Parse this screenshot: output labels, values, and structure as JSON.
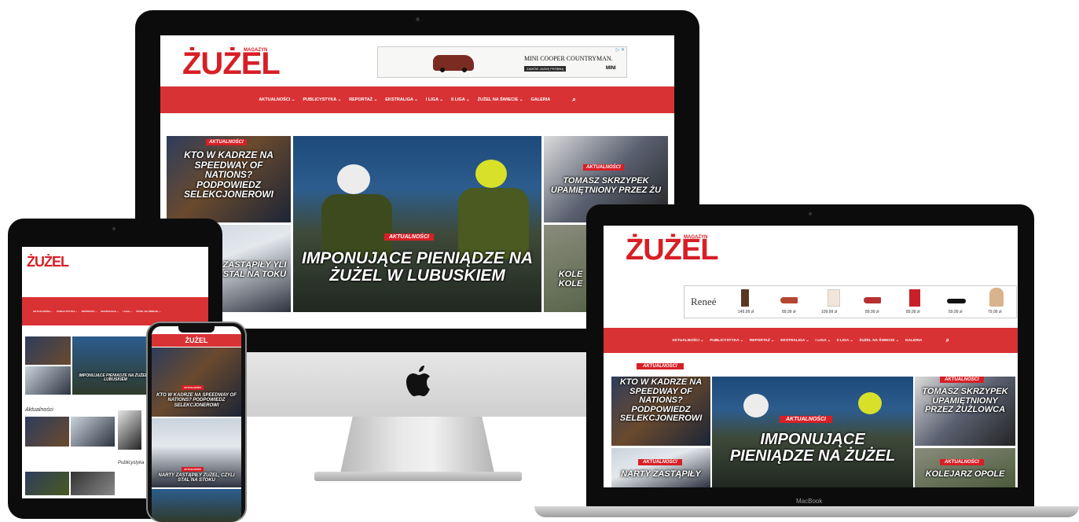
{
  "brand": {
    "logo_text": "ŻUŻEL",
    "logo_sub": "MAGAZYN",
    "accent": "#d71f26",
    "nav_color": "#d93234"
  },
  "nav": {
    "items": [
      "AKTUALNOŚCI ⌄",
      "PUBLICYSTYKA ⌄",
      "REPORTAŻ ⌄",
      "EKSTRALIGA ⌄",
      "I LIGA ⌄",
      "II LIGA ⌄",
      "ŻUŻEL NA ŚWIECIE ⌄",
      "GALERIA"
    ],
    "search_icon": "search-icon"
  },
  "ad_mini": {
    "title": "MINI COOPER COUNTRYMAN.",
    "cta": "ZAMÓW JAZDĘ PRÓBNĄ",
    "brand": "MINI",
    "badge": "▷ ✕"
  },
  "ad_renee": {
    "brand": "Reneé",
    "prices": [
      "149,99 zł",
      "89,99 zł",
      "109,99 zł",
      "89,99 zł",
      "89,99 zł",
      "59,99 zł",
      "79,99 zł"
    ]
  },
  "articles": {
    "tag": "AKTUALNOŚCI",
    "a1": "KTO W KADRZE NA SPEEDWAY OF NATIONS? PODPOWIEDZ SELEKCJONEROWI",
    "a2": "IMPONUJĄCE PIENIĄDZE NA ŻUŻEL W LUBUSKIEM",
    "a3": "TOMASZ SKRZYPEK UPAMIĘTNIONY PRZEZ ŻU",
    "a4": "ZASTĄPIŁY YLI STAL NA TOKU",
    "a5": "KOLE KOLE",
    "lap_a1": "KTO W KADRZE NA SPEEDWAY OF NATIONS? PODPOWIEDZ SELEKCJONEROWI",
    "lap_a2": "IMPONUJĄCE PIENIĄDZE NA ŻUŻEL",
    "lap_a3": "TOMASZ SKRZYPEK UPAMIĘTNIONY PRZEZ ŻUŻLOWCA",
    "lap_a4": "NARTY ZASTĄPIŁY",
    "lap_a5": "KOLEJARZ OPOLE",
    "phone_a1": "KTO W KADRZE NA SPEEDWAY OF NATIONS? PODPOWIEDZ SELEKCJONEROWI",
    "phone_a2": "NARTY ZASTĄPIŁY ŻUŻEL, CZYLI STAL NA STOKU",
    "tab_a2": "IMPONUJĄCE PIENIĄDZE NA ŻUŻEL W LUBUSKIEM",
    "tab_section1": "Aktualności",
    "tab_section2": "Publicystyka"
  },
  "devices": {
    "laptop_label": "MacBook"
  }
}
